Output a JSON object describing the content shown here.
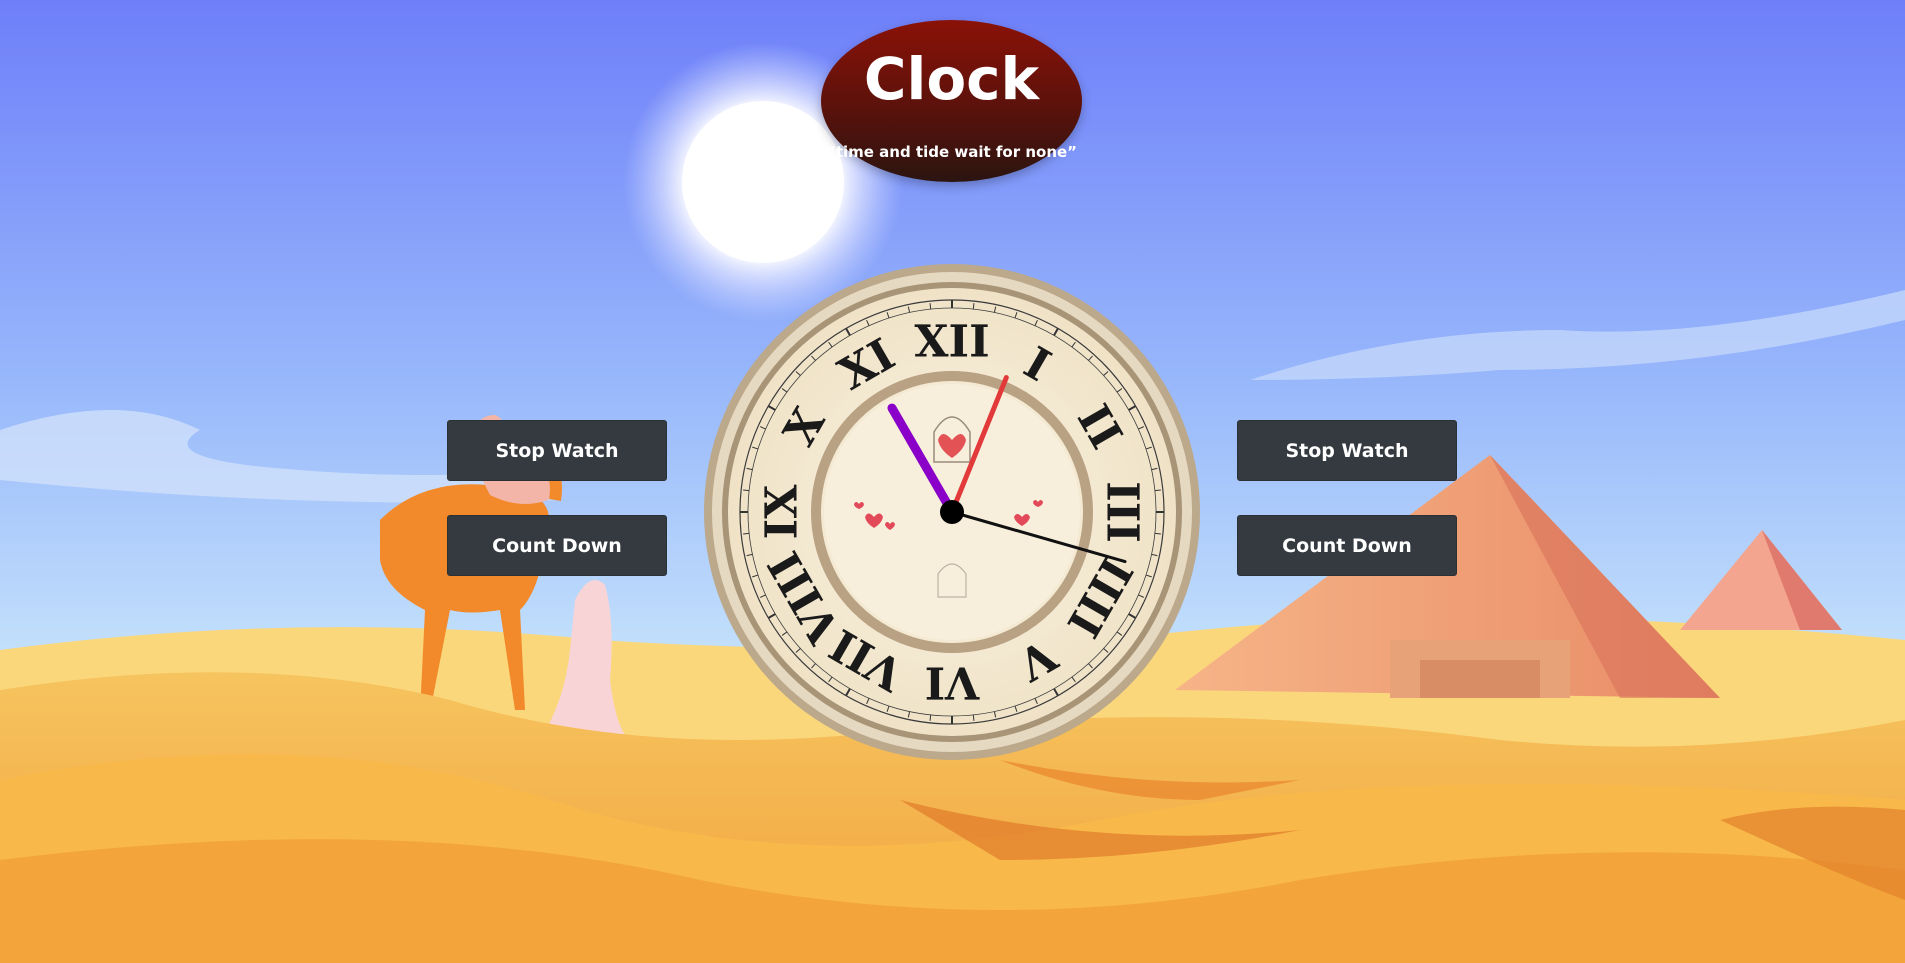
{
  "header": {
    "title": "Clock",
    "subtitle": "“time and tide wait for none”"
  },
  "left_panel": {
    "stopwatch_label": "Stop Watch",
    "countdown_label": "Count Down"
  },
  "right_panel": {
    "stopwatch_label": "Stop Watch",
    "countdown_label": "Count Down"
  },
  "clock": {
    "numerals": [
      "XII",
      "I",
      "II",
      "III",
      "IIII",
      "V",
      "VI",
      "VII",
      "VIII",
      "IX",
      "X",
      "XI"
    ],
    "hour_hand_color": "#8a00c8",
    "minute_hand_color": "#e23a3a",
    "second_hand_color": "#111111"
  }
}
